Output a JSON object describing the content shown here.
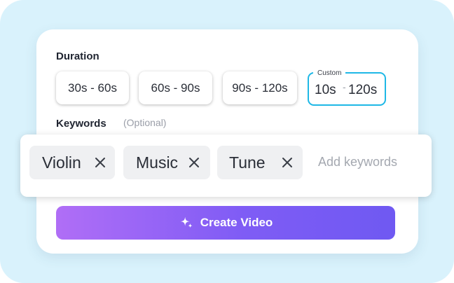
{
  "duration": {
    "label": "Duration",
    "options": [
      "30s - 60s",
      "60s - 90s",
      "90s - 120s"
    ],
    "custom": {
      "label": "Custom",
      "from": "10s",
      "separator": "-",
      "to": "120s",
      "selected": true
    }
  },
  "keywords": {
    "label": "Keywords",
    "optional_hint": "(Optional)",
    "tags": [
      "Violin",
      "Music",
      "Tune"
    ],
    "input_placeholder": "Add keywords",
    "input_value": ""
  },
  "create_button": {
    "label": "Create Video",
    "icon": "sparkle-icon"
  },
  "colors": {
    "background": "#d9f2fc",
    "custom_border": "#1fb8e6",
    "button_gradient_start": "#b06ef6",
    "button_gradient_end": "#6f59f2"
  }
}
